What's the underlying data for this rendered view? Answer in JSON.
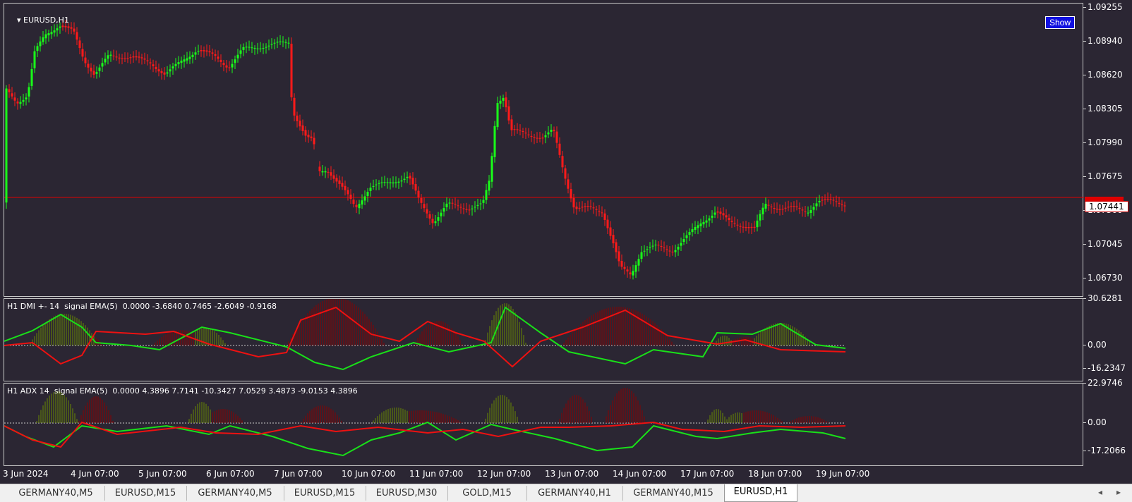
{
  "symbol_title": "EURUSD,H1",
  "show_button": "Show",
  "current_price": "1.07441",
  "main_scale": [
    "1.09255",
    "1.08940",
    "1.08620",
    "1.08305",
    "1.07990",
    "1.07675",
    "1.07360",
    "1.07045",
    "1.06730"
  ],
  "dmi": {
    "title": "H1 DMI +- 14  signal EMA(5)  0.0000 -3.6840 0.7465 -2.6049 -0.9168",
    "scale": [
      "30.6281",
      "0.00",
      "-16.2347"
    ]
  },
  "adx": {
    "title": "H1 ADX 14  signal EMA(5)  0.0000 4.3896 7.7141 -10.3427 7.0529 3.4873 -9.0153 4.3896",
    "scale": [
      "22.9746",
      "0.00",
      "-17.2066"
    ]
  },
  "time_axis": [
    "3 Jun 2024",
    "4 Jun 07:00",
    "5 Jun 07:00",
    "6 Jun 07:00",
    "7 Jun 07:00",
    "10 Jun 07:00",
    "11 Jun 07:00",
    "12 Jun 07:00",
    "13 Jun 07:00",
    "14 Jun 07:00",
    "17 Jun 07:00",
    "18 Jun 07:00",
    "19 Jun 07:00"
  ],
  "tabs": [
    "GERMANY40,M5",
    "EURUSD,M15",
    "GERMANY40,M5",
    "EURUSD,M15",
    "EURUSD,M30",
    "GOLD,M15",
    "GERMANY40,H1",
    "GERMANY40,M15",
    "EURUSD,H1"
  ],
  "active_tab": 8,
  "colors": {
    "bg": "#2b2633",
    "bull": "#19ff19",
    "bear": "#ff1a1a",
    "price_line": "#e00000"
  },
  "icons": {
    "collapse": "triangle-down-icon",
    "scroll_left": "arrow-left-icon",
    "scroll_right": "arrow-right-icon"
  }
}
